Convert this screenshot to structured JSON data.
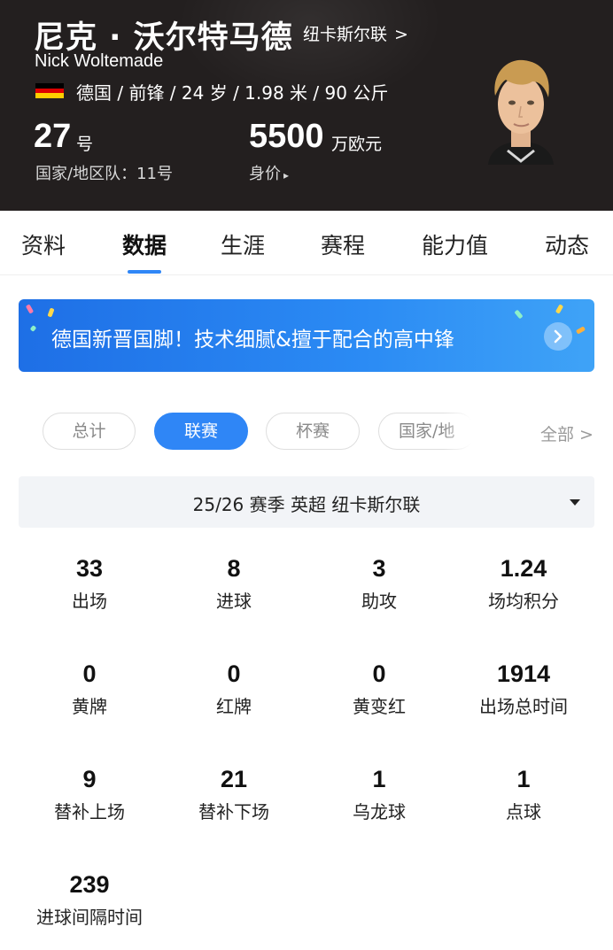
{
  "header": {
    "name_cn": "尼克 · 沃尔特马德",
    "club_link": "纽卡斯尔联",
    "club_chevron": ">",
    "name_en": "Nick Woltemade",
    "flag_colors": [
      "#000000",
      "#dd0000",
      "#ffce00"
    ],
    "info_line": "德国 / 前锋 / 24 岁 / 1.98 米 / 90 公斤",
    "number_value": "27",
    "number_unit": "号",
    "national_team_line": "国家/地区队：11号",
    "market_value": "5500",
    "market_value_unit": "万欧元",
    "market_value_label": "身价",
    "market_value_caret": "▸"
  },
  "tabs": [
    "资料",
    "数据",
    "生涯",
    "赛程",
    "能力值",
    "动态"
  ],
  "active_tab": "数据",
  "banner": {
    "text": "德国新晋国脚！技术细腻&擅于配合的高中锋",
    "icon": "chevron-right-icon"
  },
  "filters": {
    "chips": [
      "总计",
      "联赛",
      "杯赛",
      "国家/地"
    ],
    "active": "联赛",
    "all_label": "全部",
    "all_chevron": ">"
  },
  "season_selector": {
    "value": "25/26 赛季  英超  纽卡斯尔联"
  },
  "stats": [
    {
      "value": "33",
      "label": "出场"
    },
    {
      "value": "8",
      "label": "进球"
    },
    {
      "value": "3",
      "label": "助攻"
    },
    {
      "value": "1.24",
      "label": "场均积分"
    },
    {
      "value": "0",
      "label": "黄牌"
    },
    {
      "value": "0",
      "label": "红牌"
    },
    {
      "value": "0",
      "label": "黄变红"
    },
    {
      "value": "1914",
      "label": "出场总时间"
    },
    {
      "value": "9",
      "label": "替补上场"
    },
    {
      "value": "21",
      "label": "替补下场"
    },
    {
      "value": "1",
      "label": "乌龙球"
    },
    {
      "value": "1",
      "label": "点球"
    },
    {
      "value": "239",
      "label": "进球间隔时间"
    }
  ],
  "colors": {
    "header_bg": "#231f1f",
    "accent": "#2f86f6",
    "banner_start": "#1e6fe6",
    "banner_end": "#3fa3f7"
  }
}
